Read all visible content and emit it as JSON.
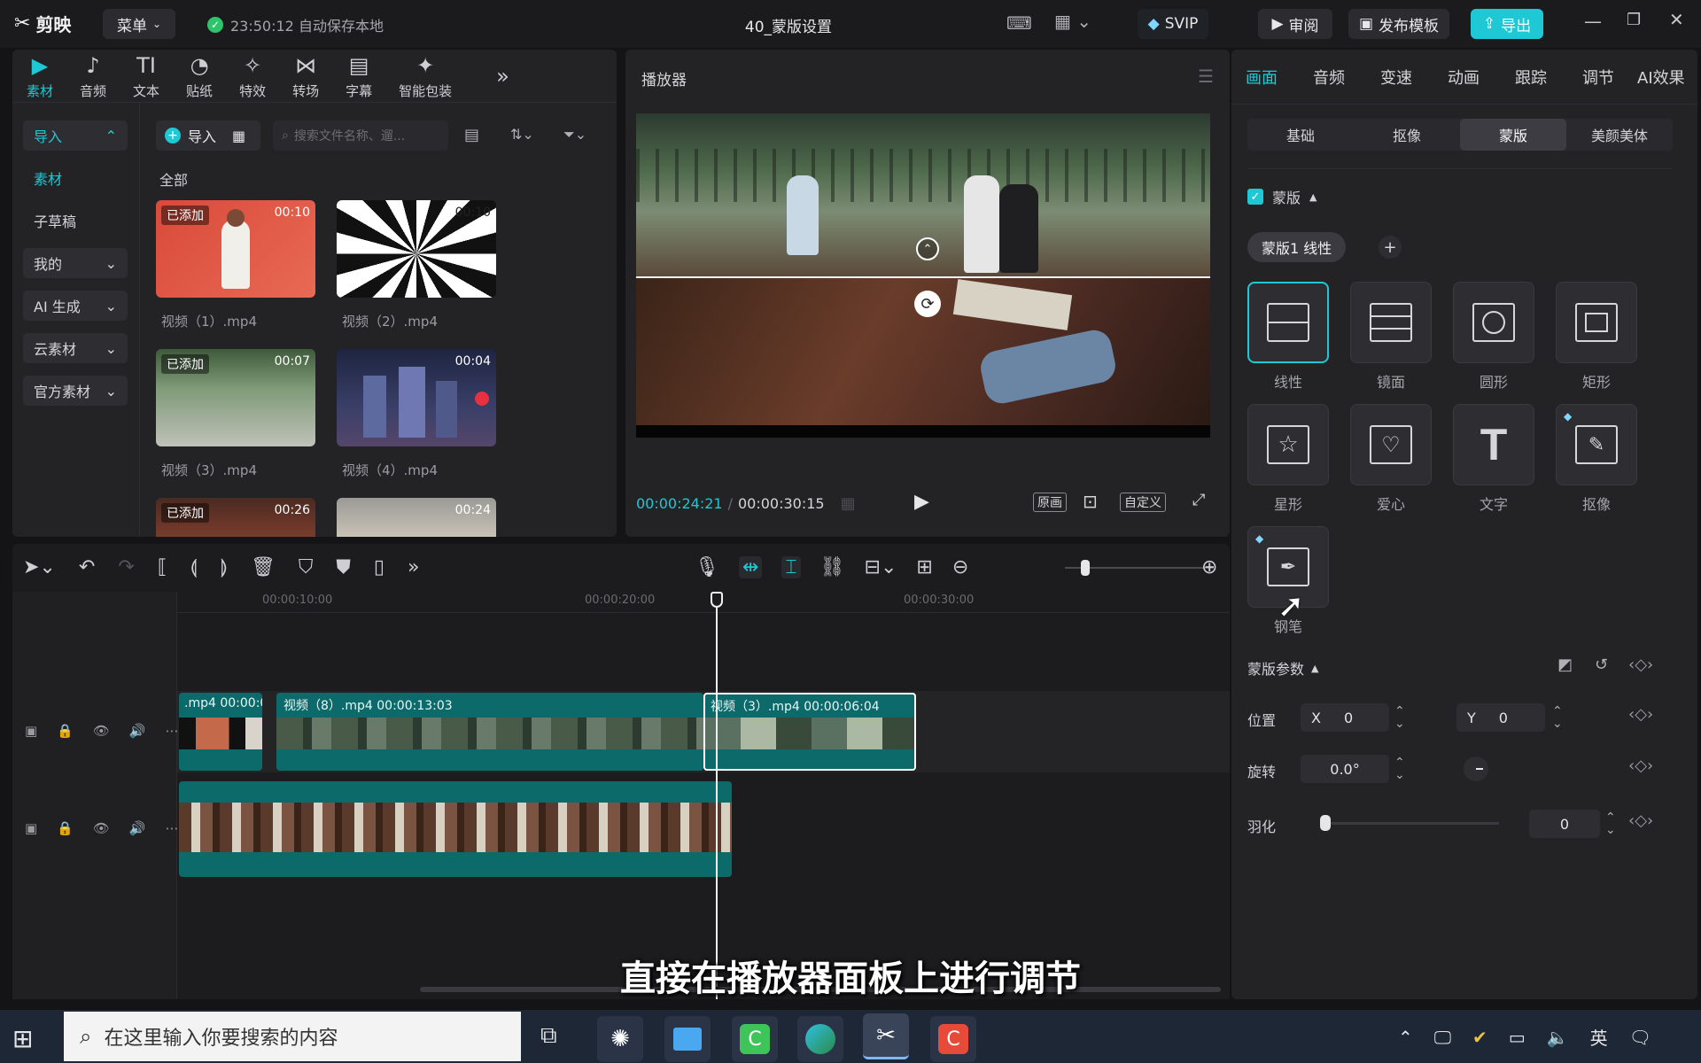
{
  "app": {
    "logo": "剪映",
    "menu": "菜单",
    "autosave": "23:50:12 自动保存本地",
    "project_title": "40_蒙版设置",
    "svip": "SVIP",
    "review": "审阅",
    "publish_template": "发布模板",
    "export": "导出"
  },
  "media_tools": [
    {
      "label": "素材",
      "icon": "media-icon"
    },
    {
      "label": "音频",
      "icon": "audio-icon"
    },
    {
      "label": "文本",
      "icon": "text-icon"
    },
    {
      "label": "贴纸",
      "icon": "sticker-icon"
    },
    {
      "label": "特效",
      "icon": "effects-icon"
    },
    {
      "label": "转场",
      "icon": "transition-icon"
    },
    {
      "label": "字幕",
      "icon": "subtitle-icon"
    },
    {
      "label": "智能包装",
      "icon": "smart-pack-icon"
    }
  ],
  "sidebar": {
    "items": [
      {
        "label": "导入",
        "chev": "⌃"
      },
      {
        "label": "素材",
        "chev": ""
      },
      {
        "label": "子草稿",
        "chev": ""
      },
      {
        "label": "我的",
        "chev": "⌄"
      },
      {
        "label": "AI 生成",
        "chev": "⌄"
      },
      {
        "label": "云素材",
        "chev": "⌄"
      },
      {
        "label": "官方素材",
        "chev": "⌄"
      }
    ]
  },
  "media": {
    "import_btn": "导入",
    "search_placeholder": "搜索文件名称、遛...",
    "section": "全部",
    "clips": [
      {
        "name": "视频（1）.mp4",
        "duration": "00:10",
        "added": "已添加"
      },
      {
        "name": "视频（2）.mp4",
        "duration": "00:10",
        "added": ""
      },
      {
        "name": "视频（3）.mp4",
        "duration": "00:07",
        "added": "已添加"
      },
      {
        "name": "视频（4）.mp4",
        "duration": "00:04",
        "added": ""
      },
      {
        "name": "",
        "duration": "00:26",
        "added": "已添加"
      },
      {
        "name": "",
        "duration": "00:24",
        "added": ""
      }
    ]
  },
  "player": {
    "title": "播放器",
    "current": "00:00:24:21",
    "separator": "/",
    "total": "00:00:30:15",
    "original": "原画",
    "custom": "自定义"
  },
  "timeline": {
    "ruler": [
      "00:00:10:00",
      "00:00:20:00",
      "00:00:30:00"
    ],
    "clips": [
      {
        "name": ".mp4",
        "time": "00:00:0"
      },
      {
        "name": "视频（8）.mp4",
        "time": "00:00:13:03"
      },
      {
        "name": "视频（3）.mp4",
        "time": "00:00:06:04"
      }
    ]
  },
  "subtitle": "直接在播放器面板上进行调节",
  "right": {
    "tabs": [
      "画面",
      "音频",
      "变速",
      "动画",
      "跟踪",
      "调节",
      "AI效果"
    ],
    "active_tab": "画面",
    "subtabs": [
      "基础",
      "抠像",
      "蒙版",
      "美颜美体"
    ],
    "active_subtab": "蒙版",
    "mask_section": "蒙版",
    "mask_chip": "蒙版1 线性",
    "masks": [
      {
        "label": "线性",
        "icon": "linear-mask-icon"
      },
      {
        "label": "镜面",
        "icon": "mirror-mask-icon"
      },
      {
        "label": "圆形",
        "icon": "circle-mask-icon"
      },
      {
        "label": "矩形",
        "icon": "rect-mask-icon"
      },
      {
        "label": "星形",
        "icon": "star-mask-icon"
      },
      {
        "label": "爱心",
        "icon": "heart-mask-icon"
      },
      {
        "label": "文字",
        "icon": "text-mask-icon"
      },
      {
        "label": "抠像",
        "icon": "matting-mask-icon"
      },
      {
        "label": "钢笔",
        "icon": "pen-mask-icon"
      }
    ],
    "params_title": "蒙版参数",
    "pos_label": "位置",
    "x_label": "X",
    "x_val": "0",
    "y_label": "Y",
    "y_val": "0",
    "rot_label": "旋转",
    "rot_val": "0.0°",
    "feather_label": "羽化",
    "feather_val": "0",
    "feather_level": 0
  },
  "taskbar": {
    "search_placeholder": "在这里输入你要搜索的内容",
    "ime": "英"
  },
  "colors": {
    "accent": "#1ec8d4",
    "clip": "#0d6a6a",
    "bg": "#141416",
    "panel": "#232326"
  }
}
